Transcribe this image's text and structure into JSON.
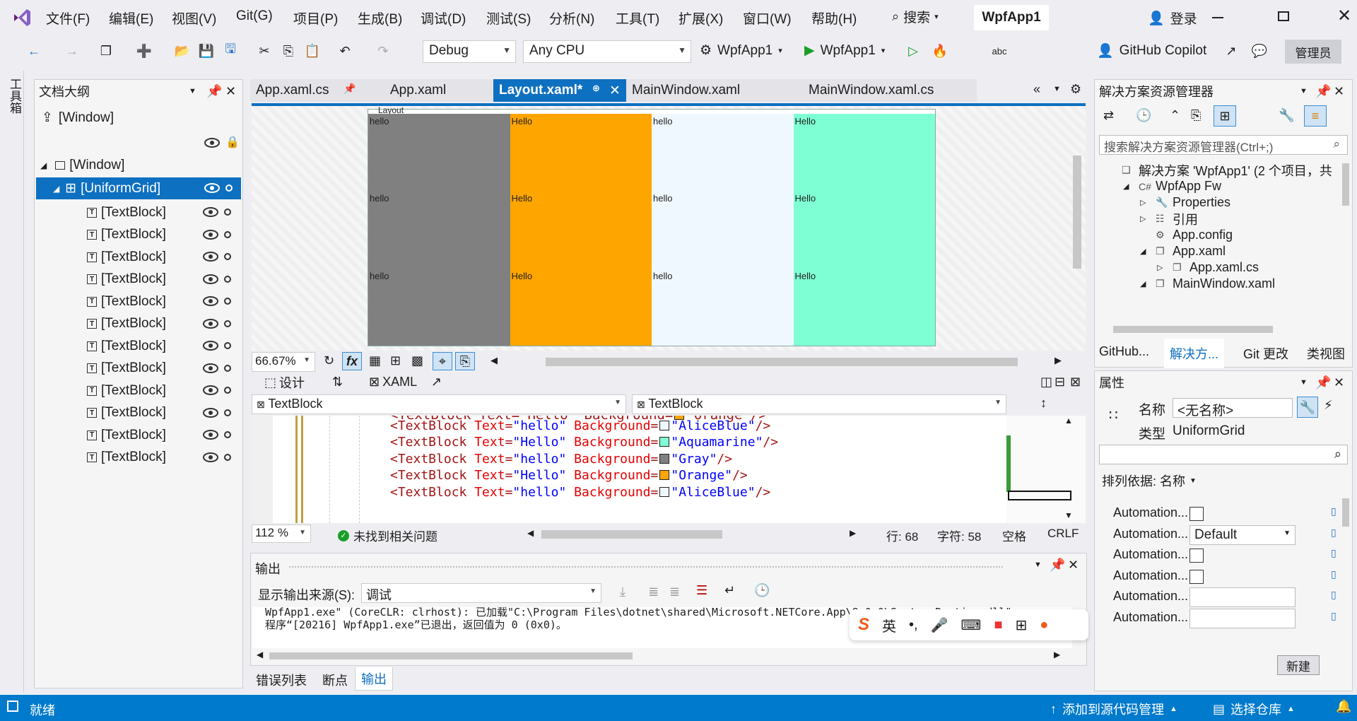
{
  "menu": {
    "items": [
      "文件(F)",
      "编辑(E)",
      "视图(V)",
      "Git(G)",
      "项目(P)",
      "生成(B)",
      "调试(D)",
      "测试(S)",
      "分析(N)",
      "工具(T)",
      "扩展(X)",
      "窗口(W)",
      "帮助(H)"
    ],
    "search_label": "搜索",
    "app_title": "WpfApp1",
    "login_label": "登录"
  },
  "toolbar": {
    "config_value": "Debug",
    "platform_value": "Any CPU",
    "startup_project": "WpfApp1",
    "run_label": "WpfApp1",
    "copilot_label": "GitHub Copilot",
    "admin_label": "管理员"
  },
  "toolstrip": {
    "label": "工具箱"
  },
  "outline": {
    "title": "文档大纲",
    "root": "[Window]",
    "window_node": "[Window]",
    "grid_node": "[UniformGrid]",
    "textblocks": [
      "[TextBlock]",
      "[TextBlock]",
      "[TextBlock]",
      "[TextBlock]",
      "[TextBlock]",
      "[TextBlock]",
      "[TextBlock]",
      "[TextBlock]",
      "[TextBlock]",
      "[TextBlock]",
      "[TextBlock]",
      "[TextBlock]"
    ]
  },
  "doc_tabs": [
    {
      "label": "App.xaml.cs",
      "active": false
    },
    {
      "label": "App.xaml",
      "active": false
    },
    {
      "label": "Layout.xaml*",
      "active": true
    },
    {
      "label": "MainWindow.xaml",
      "active": false
    },
    {
      "label": "MainWindow.xaml.cs",
      "active": false
    }
  ],
  "designer": {
    "layout_label": "Layout",
    "cells": [
      {
        "text": "hello",
        "color": "#808080"
      },
      {
        "text": "Hello",
        "color": "#FFA500"
      },
      {
        "text": "hello",
        "color": "#F0F8FF"
      },
      {
        "text": "Hello",
        "color": "#7FFFD4"
      },
      {
        "text": "hello",
        "color": "#808080"
      },
      {
        "text": "Hello",
        "color": "#FFA500"
      },
      {
        "text": "hello",
        "color": "#F0F8FF"
      },
      {
        "text": "Hello",
        "color": "#7FFFD4"
      },
      {
        "text": "hello",
        "color": "#808080"
      },
      {
        "text": "Hello",
        "color": "#FFA500"
      },
      {
        "text": "hello",
        "color": "#F0F8FF"
      },
      {
        "text": "Hello",
        "color": "#7FFFD4"
      }
    ],
    "zoom": "66.67%",
    "fx_label": "fx"
  },
  "split": {
    "design_tab": "设计",
    "xaml_tab": "XAML",
    "left_combo": "TextBlock",
    "right_combo": "TextBlock"
  },
  "code": {
    "lines": [
      {
        "text": "hello",
        "bg": "AliceBlue",
        "color": "#F0F8FF"
      },
      {
        "text": "Hello",
        "bg": "Aquamarine",
        "color": "#7FFFD4"
      },
      {
        "text": "hello",
        "bg": "Gray",
        "color": "#808080"
      },
      {
        "text": "Hello",
        "bg": "Orange",
        "color": "#FFA500"
      },
      {
        "text": "hello",
        "bg": "AliceBlue",
        "color": "#F0F8FF"
      }
    ],
    "zoom": "112 %",
    "issues": "未找到相关问题",
    "line": "行: 68",
    "char": "字符: 58",
    "space": "空格",
    "eol": "CRLF"
  },
  "output": {
    "title": "输出",
    "source_label": "显示输出来源(S):",
    "source_value": "调试",
    "line1": "WpfApp1.exe\" (CoreCLR: clrhost): 已加载\"C:\\Program Files\\dotnet\\shared\\Microsoft.NETCore.App\\8.0.0\\System.Runtime.dll\"",
    "line2": "程序“[20216] WpfApp1.exe”已退出，返回值为 0 (0x0)。"
  },
  "bottom_tabs": [
    "错误列表",
    "断点",
    "输出"
  ],
  "ime": {
    "lang": "英"
  },
  "solution": {
    "title": "解决方案资源管理器",
    "search_placeholder": "搜索解决方案资源管理器(Ctrl+;)",
    "nodes": [
      {
        "label": "解决方案 'WpfApp1' (2 个项目，共",
        "indent": 0
      },
      {
        "label": "WpfApp Fw",
        "indent": 1
      },
      {
        "label": "Properties",
        "indent": 2
      },
      {
        "label": "引用",
        "indent": 2
      },
      {
        "label": "App.config",
        "indent": 2
      },
      {
        "label": "App.xaml",
        "indent": 2
      },
      {
        "label": "App.xaml.cs",
        "indent": 3
      },
      {
        "label": "MainWindow.xaml",
        "indent": 2
      }
    ],
    "tabs": [
      "GitHub...",
      "解决方...",
      "Git 更改",
      "类视图"
    ]
  },
  "properties": {
    "title": "属性",
    "name_label": "名称",
    "name_value": "<无名称>",
    "type_label": "类型",
    "type_value": "UniformGrid",
    "sort_label": "排列依据: 名称",
    "rows": [
      "Automation...",
      "Automation...",
      "Automation...",
      "Automation...",
      "Automation...",
      "Automation..."
    ],
    "default_value": "Default",
    "new_button": "新建"
  },
  "status": {
    "ready": "就绪",
    "add_source": "添加到源代码管理",
    "select_repo": "选择仓库"
  }
}
